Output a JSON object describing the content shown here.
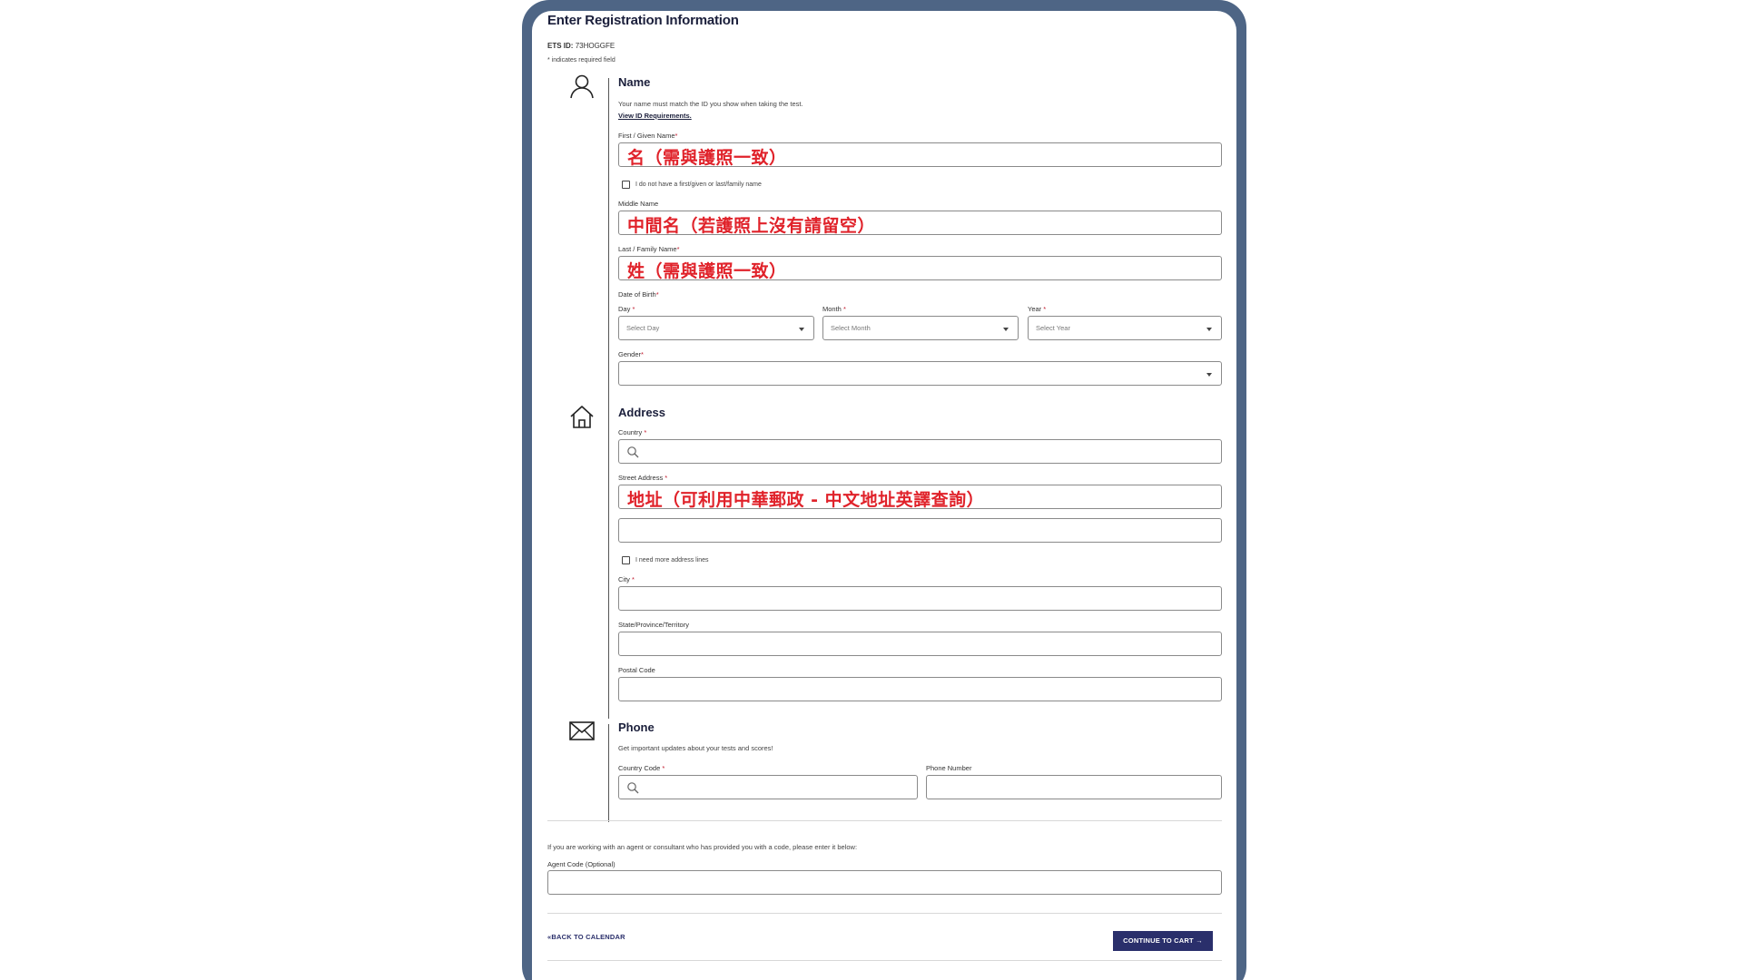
{
  "page": {
    "title": "Enter Registration Information",
    "ets_id_label": "ETS ID:",
    "ets_id_value": "73HOGGFE",
    "required_note": "* indicates required field"
  },
  "name_section": {
    "title": "Name",
    "helper": "Your name must match the ID you show when taking the test.",
    "id_link": "View ID Requirements.",
    "first_label": "First / Given Name",
    "first_overlay": "名（需與護照一致）",
    "no_name_checkbox": "I do not have a first/given or last/family name",
    "middle_label": "Middle Name",
    "middle_overlay": "中間名（若護照上沒有請留空）",
    "last_label": "Last / Family Name",
    "last_overlay": "姓（需與護照一致）",
    "dob_label": "Date of Birth",
    "day_label": "Day",
    "day_placeholder": "Select Day",
    "month_label": "Month",
    "month_placeholder": "Select Month",
    "year_label": "Year",
    "year_placeholder": "Select Year",
    "gender_label": "Gender",
    "gender_value": ""
  },
  "address_section": {
    "title": "Address",
    "country_label": "Country",
    "street_label": "Street Address",
    "street_overlay": "地址（可利用中華郵政 - 中文地址英譯查詢）",
    "more_lines_checkbox": "I need more address lines",
    "city_label": "City",
    "state_label": "State/Province/Territory",
    "postal_label": "Postal Code"
  },
  "phone_section": {
    "title": "Phone",
    "helper": "Get important updates about your tests and scores!",
    "country_code_label": "Country Code",
    "phone_label": "Phone Number"
  },
  "agent": {
    "note": "If you are working with an agent or consultant who has provided you with a code, please enter it below:",
    "label": "Agent Code (Optional)"
  },
  "footer": {
    "back_label": "BACK TO CALENDAR",
    "continue_label": "CONTINUE TO CART"
  },
  "colors": {
    "frame": "#4e6585",
    "primary": "#2a2f6b",
    "required": "#c0192c",
    "overlay_text": "#e0222a"
  },
  "icons": [
    "person-icon",
    "house-icon",
    "envelope-icon",
    "search-icon",
    "chevron-down-icon",
    "double-chevron-left-icon",
    "arrow-right-icon"
  ]
}
